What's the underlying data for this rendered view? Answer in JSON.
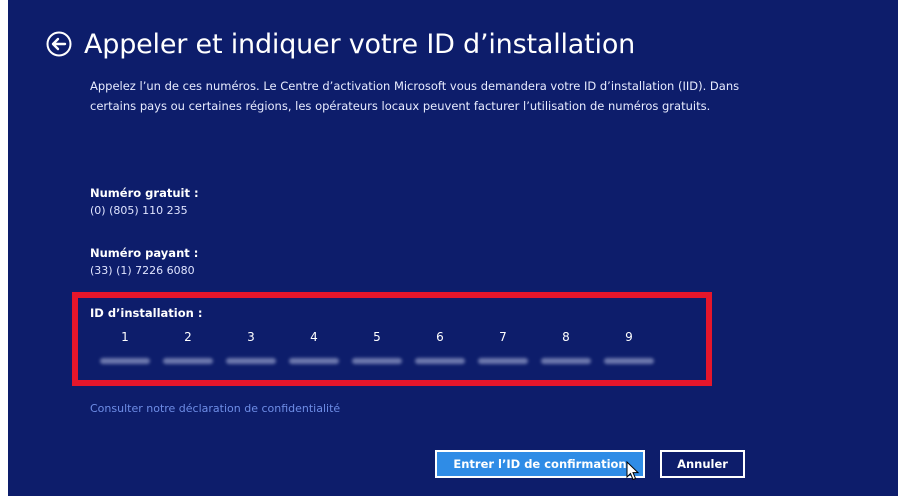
{
  "header": {
    "title": "Appeler et indiquer votre ID d’installation",
    "back_icon": "back-arrow-circle-icon"
  },
  "description": "Appelez l’un de ces numéros. Le Centre d’activation Microsoft vous demandera votre ID d’installation (IID). Dans certains pays ou certaines régions, les opérateurs locaux peuvent facturer l’utilisation de numéros gratuits.",
  "toll_free": {
    "label": "Numéro gratuit :",
    "value": "(0) (805) 110 235"
  },
  "toll": {
    "label": "Numéro payant :",
    "value": "(33) (1) 7226 6080"
  },
  "installation_id": {
    "label": "ID d’installation :",
    "groups": [
      "1",
      "2",
      "3",
      "4",
      "5",
      "6",
      "7",
      "8",
      "9"
    ],
    "highlight_color": "#e4162b"
  },
  "privacy_link": "Consulter notre déclaration de confidentialité",
  "buttons": {
    "confirm": "Entrer l’ID de confirmation",
    "cancel": "Annuler"
  },
  "colors": {
    "background": "#0d1d6b",
    "primary_button": "#2f8ce6",
    "link": "#6e8de6"
  }
}
